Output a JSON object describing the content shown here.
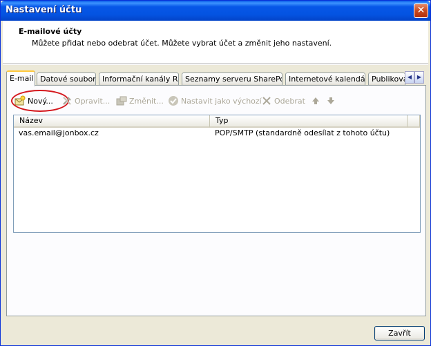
{
  "window": {
    "title": "Nastavení účtu",
    "close_symbol": "✕"
  },
  "header": {
    "title": "E-mailové účty",
    "subtitle": "Můžete přidat nebo odebrat účet. Můžete vybrat účet a změnit jeho nastavení."
  },
  "tabs": [
    {
      "label": "E-mail",
      "active": true
    },
    {
      "label": "Datové soubory"
    },
    {
      "label": "Informační kanály RSS"
    },
    {
      "label": "Seznamy serveru SharePoint"
    },
    {
      "label": "Internetové kalendáře"
    },
    {
      "label": "Publikovan"
    }
  ],
  "toolbar": {
    "new": "Nový...",
    "repair": "Opravit...",
    "change": "Změnit...",
    "set_default": "Nastavit jako výchozí",
    "remove": "Odebrat"
  },
  "list": {
    "columns": [
      "Název",
      "Typ"
    ],
    "rows": [
      {
        "name": "vas.email@jonbox.cz",
        "type": "POP/SMTP (standardně odesílat z tohoto účtu)"
      }
    ]
  },
  "footer": {
    "close_label": "Zavřít"
  },
  "colors": {
    "highlight_ellipse": "#d4161c",
    "titlebar": "#0453e1"
  }
}
